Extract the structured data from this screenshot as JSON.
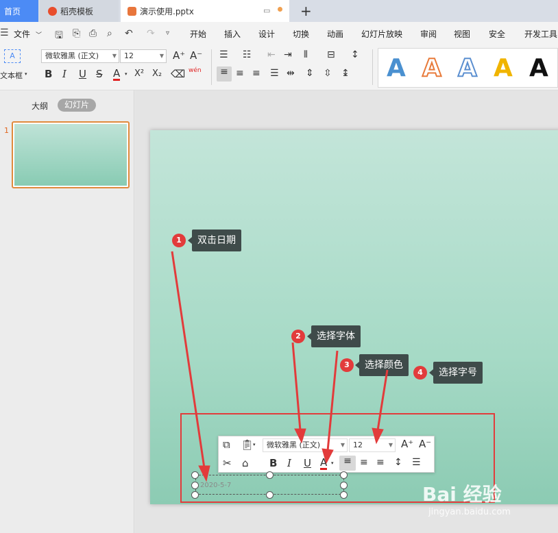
{
  "tabs": {
    "home": "首页",
    "template": "稻壳模板",
    "document": "演示使用.pptx"
  },
  "menu": {
    "file": "文件",
    "items": [
      "开始",
      "插入",
      "设计",
      "切换",
      "动画",
      "幻灯片放映",
      "审阅",
      "视图",
      "安全",
      "开发工具"
    ]
  },
  "ribbon": {
    "textbox_label": "文本框",
    "font_name": "微软雅黑 (正文)",
    "font_size": "12",
    "bold": "B",
    "italic": "I",
    "underline": "U",
    "strike": "S",
    "font_color": "A",
    "superscript": "X²",
    "subscript": "X₂",
    "phonetic": "wén",
    "art_styles": [
      "A",
      "A",
      "A",
      "A",
      "A"
    ],
    "art_colors": [
      "#111111",
      "#4a90d0",
      "#e87a3a",
      "#5b8fd0",
      "#f0b400"
    ]
  },
  "left_panel": {
    "outline_tab": "大纲",
    "slides_tab": "幻灯片",
    "slide_number": "1"
  },
  "callouts": [
    {
      "num": "1",
      "text": "双击日期"
    },
    {
      "num": "2",
      "text": "选择字体"
    },
    {
      "num": "3",
      "text": "选择颜色"
    },
    {
      "num": "4",
      "text": "选择字号"
    }
  ],
  "mini_toolbar": {
    "font_name": "微软雅黑 (正文)",
    "font_size": "12",
    "bold": "B",
    "italic": "I",
    "underline": "U",
    "font_color": "A"
  },
  "date_text": "2020-5-7",
  "watermark": {
    "main": "Bai 经验",
    "sub": "jingyan.baidu.com"
  },
  "colors": {
    "accent_tab": "#4c8bf5",
    "callout_red": "#e23b3b",
    "callout_bg": "#3f4b4a",
    "slide_top": "#c3e5d9",
    "slide_bottom": "#8ccbb3"
  }
}
